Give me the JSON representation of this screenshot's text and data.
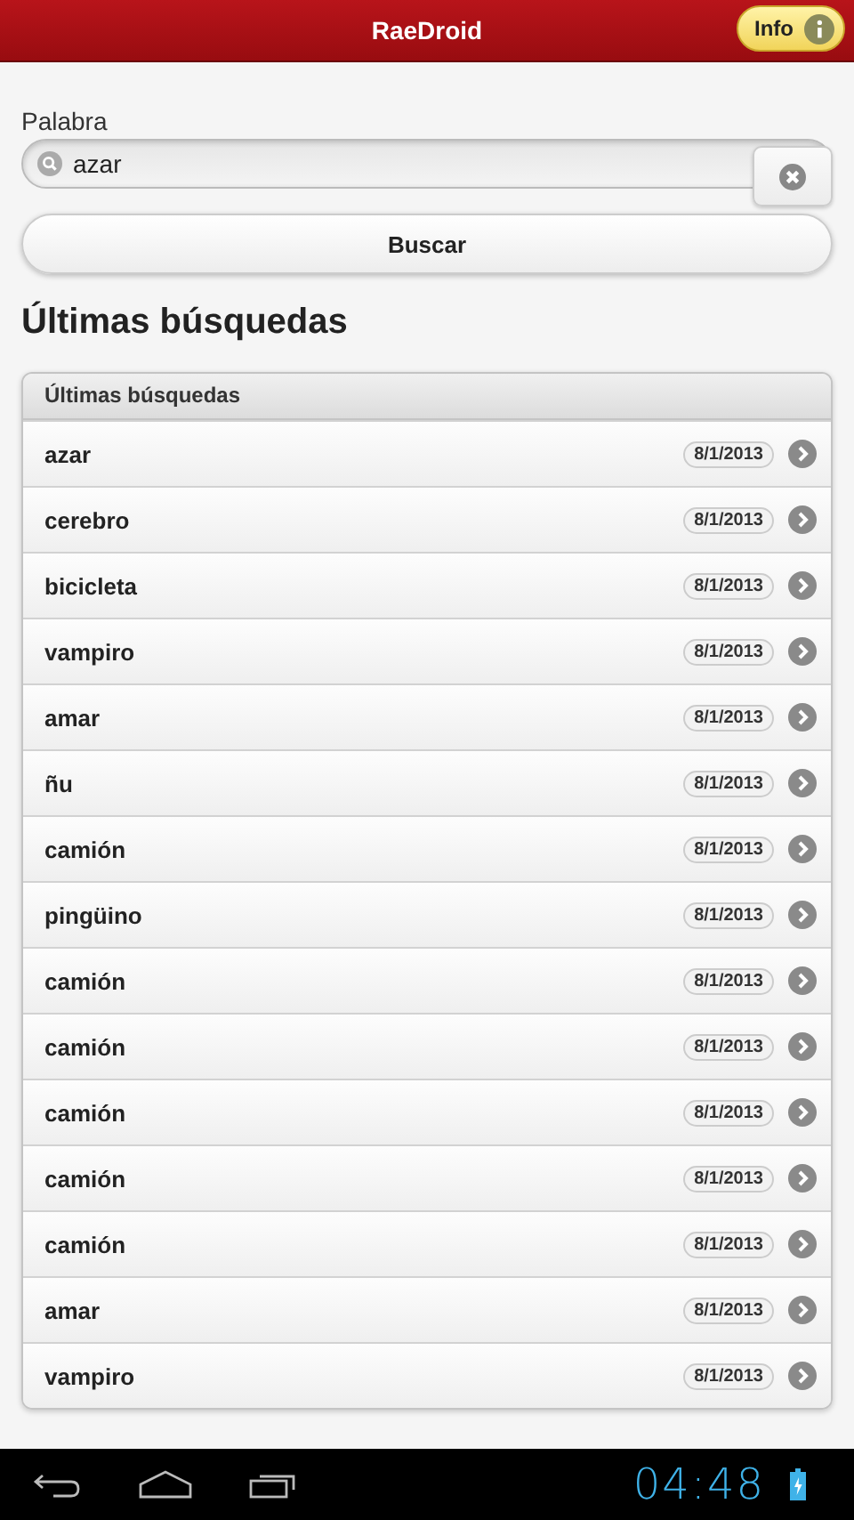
{
  "header": {
    "title": "RaeDroid",
    "info_button": "Info"
  },
  "search": {
    "label": "Palabra",
    "value": "azar",
    "button": "Buscar"
  },
  "section_title": "Últimas búsquedas",
  "list": {
    "header": "Últimas búsquedas",
    "items": [
      {
        "word": "azar",
        "date": "8/1/2013"
      },
      {
        "word": "cerebro",
        "date": "8/1/2013"
      },
      {
        "word": "bicicleta",
        "date": "8/1/2013"
      },
      {
        "word": "vampiro",
        "date": "8/1/2013"
      },
      {
        "word": "amar",
        "date": "8/1/2013"
      },
      {
        "word": "ñu",
        "date": "8/1/2013"
      },
      {
        "word": "camión",
        "date": "8/1/2013"
      },
      {
        "word": "pingüino",
        "date": "8/1/2013"
      },
      {
        "word": "camión",
        "date": "8/1/2013"
      },
      {
        "word": "camión",
        "date": "8/1/2013"
      },
      {
        "word": "camión",
        "date": "8/1/2013"
      },
      {
        "word": "camión",
        "date": "8/1/2013"
      },
      {
        "word": "camión",
        "date": "8/1/2013"
      },
      {
        "word": "amar",
        "date": "8/1/2013"
      },
      {
        "word": "vampiro",
        "date": "8/1/2013"
      }
    ]
  },
  "nav_bar": {
    "time": "04:48"
  }
}
